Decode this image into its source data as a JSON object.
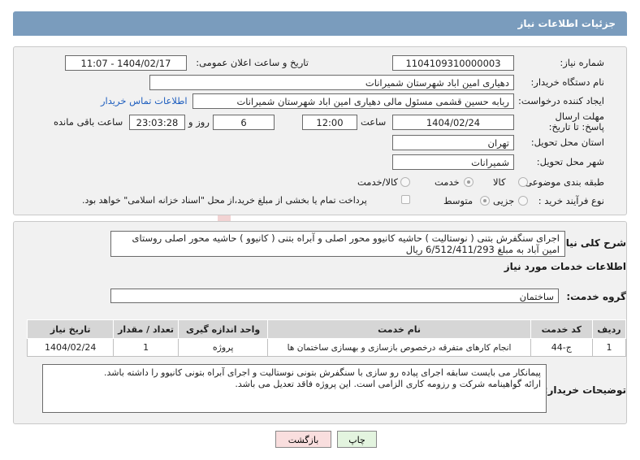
{
  "header": {
    "title": "جزئیات اطلاعات نیاز"
  },
  "form": {
    "need_number_label": "شماره نیاز:",
    "need_number": "1104109310000003",
    "announce_label": "تاریخ و ساعت اعلان عمومی:",
    "announce_value": "1404/02/17 - 11:07",
    "buyer_org_label": "نام دستگاه خریدار:",
    "buyer_org": "دهیاری امین اباد شهرستان شمیرانات",
    "creator_label": "ایجاد کننده درخواست:",
    "creator": "ربابه حسین قشمی مسئول مالی دهیاری امین اباد شهرستان شمیرانات",
    "contact_link": "اطلاعات تماس خریدار",
    "deadline_label": "مهلت ارسال پاسخ: تا تاریخ:",
    "deadline_date": "1404/02/24",
    "time_label": "ساعت",
    "deadline_time": "12:00",
    "days_value": "6",
    "days_label": "روز و",
    "remaining_time": "23:03:28",
    "remaining_label": "ساعت باقی مانده",
    "province_label": "استان محل تحویل:",
    "province": "تهران",
    "city_label": "شهر محل تحویل:",
    "city": "شمیرانات",
    "category_label": "طبقه بندی موضوعی:",
    "category_options": [
      "کالا",
      "خدمت",
      "کالا/خدمت"
    ],
    "process_label": "نوع فرآیند خرید :",
    "process_options": [
      "جزیی",
      "متوسط"
    ],
    "payment_note": "پرداخت تمام یا بخشی از مبلغ خرید،از محل \"اسناد خزانه اسلامی\" خواهد بود."
  },
  "summary": {
    "label": "شرح کلی نیاز:",
    "text": "اجرای سنگفرش بتنی ( نوستالیت ) حاشیه کانیوو محور اصلی و آبراه بتنی ( کانیوو ) حاشیه محور اصلی روستای امین آباد به مبلغ 6/512/411/293 ریال"
  },
  "services": {
    "section_title": "اطلاعات خدمات مورد نیاز",
    "group_label": "گروه خدمت:",
    "group_value": "ساختمان",
    "columns": [
      "ردیف",
      "کد خدمت",
      "نام خدمت",
      "واحد اندازه گیری",
      "تعداد / مقدار",
      "تاریخ نیاز"
    ],
    "rows": [
      [
        "1",
        "ج-44",
        "انجام کارهای متفرقه درخصوص بازسازی و بهسازی ساختمان ها",
        "پروژه",
        "1",
        "1404/02/24"
      ]
    ]
  },
  "buyer_notes": {
    "label": "توضیحات خریدار:",
    "line1": "پیمانکار می بایست سابقه  اجرای پیاده رو سازی  با سنگفرش بتونی نوستالیت و اجرای آبراه بتونی کانیوو را داشته باشد.",
    "line2": "ارائه گواهینامه شرکت و رزومه کاری الزامی است. این پروژه فاقد تعدیل می باشد."
  },
  "buttons": {
    "print": "چاپ",
    "back": "بازگشت"
  },
  "watermark": {
    "text": "AriaTender.neT"
  },
  "colors": {
    "header": "#7a9cbd",
    "link": "#1f5fbf",
    "back_button": "#f9dede",
    "print_button": "#e3f4df"
  }
}
